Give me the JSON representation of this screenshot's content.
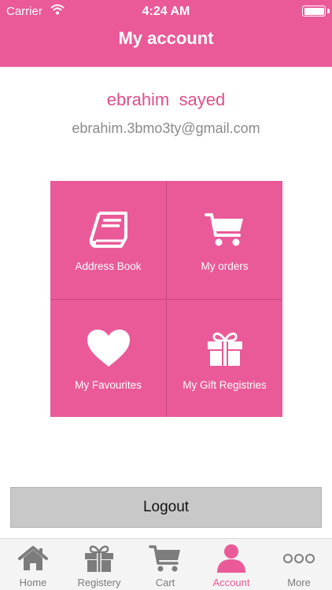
{
  "status_bar": {
    "carrier": "Carrier",
    "time": "4:24 AM",
    "battery_level": 1.0
  },
  "header": {
    "title": "My account"
  },
  "user": {
    "name": "ebrahim  sayed",
    "email": "ebrahim.3bmo3ty@gmail.com"
  },
  "menu": [
    {
      "label": "Address Book",
      "icon": "address-book-icon"
    },
    {
      "label": "My orders",
      "icon": "cart-icon"
    },
    {
      "label": "My Favourites",
      "icon": "heart-icon"
    },
    {
      "label": "My Gift Registries",
      "icon": "gift-icon"
    }
  ],
  "logout_label": "Logout",
  "tabs": [
    {
      "label": "Home",
      "icon": "home-icon"
    },
    {
      "label": "Registery",
      "icon": "gift-icon"
    },
    {
      "label": "Cart",
      "icon": "cart-icon"
    },
    {
      "label": "Account",
      "icon": "person-icon",
      "active": true
    },
    {
      "label": "More",
      "icon": "more-icon"
    }
  ],
  "colors": {
    "accent": "#ea5a98",
    "tab_inactive": "#7c7c7c",
    "logout_bg": "#c8c8c8"
  }
}
